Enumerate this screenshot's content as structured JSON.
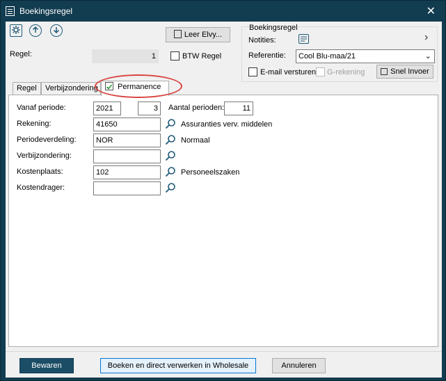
{
  "window": {
    "title": "Boekingsregel",
    "close_symbol": "✕"
  },
  "toolbar": {
    "icons": [
      "settings-icon",
      "arrow-up-icon",
      "arrow-down-icon"
    ],
    "leer_elvy_label": "Leer Elvy..."
  },
  "regel": {
    "label": "Regel:",
    "value": "1",
    "btw_label": "BTW Regel"
  },
  "boekingsregel_group": {
    "title": "Boekingsregel",
    "notities_label": "Notities:",
    "referentie_label": "Referentie:",
    "referentie_value": "Cool Blu-maa/21",
    "email_label": "E-mail versturen",
    "grekening_label": "G-rekening",
    "snel_invoer_label": "Snel Invoer"
  },
  "tabs": [
    {
      "label": "Regel"
    },
    {
      "label": "Verbijzondering"
    },
    {
      "label": "Permanence"
    }
  ],
  "form": {
    "vanaf_label": "Vanaf periode:",
    "vanaf_year": "2021",
    "vanaf_period": "3",
    "aantal_label": "Aantal perioden:",
    "aantal_value": "11",
    "rekening_label": "Rekening:",
    "rekening_value": "41650",
    "rekening_desc": "Assuranties verv. middelen",
    "periodeverdeling_label": "Periodeverdeling:",
    "periodeverdeling_value": "NOR",
    "periodeverdeling_desc": "Normaal",
    "verbijzondering_label": "Verbijzondering:",
    "verbijzondering_value": "",
    "kostenplaats_label": "Kostenplaats:",
    "kostenplaats_value": "102",
    "kostenplaats_desc": "Personeelszaken",
    "kostendrager_label": "Kostendrager:",
    "kostendrager_value": ""
  },
  "footer": {
    "bewaren_label": "Bewaren",
    "boeken_label": "Boeken en direct verwerken in Wholesale",
    "annuleren_label": "Annuleren"
  },
  "colors": {
    "titlebar": "#123c50",
    "primary_button": "#1b4d66",
    "highlight_ring": "#d9443f",
    "icon_accent": "#1f5a78"
  }
}
